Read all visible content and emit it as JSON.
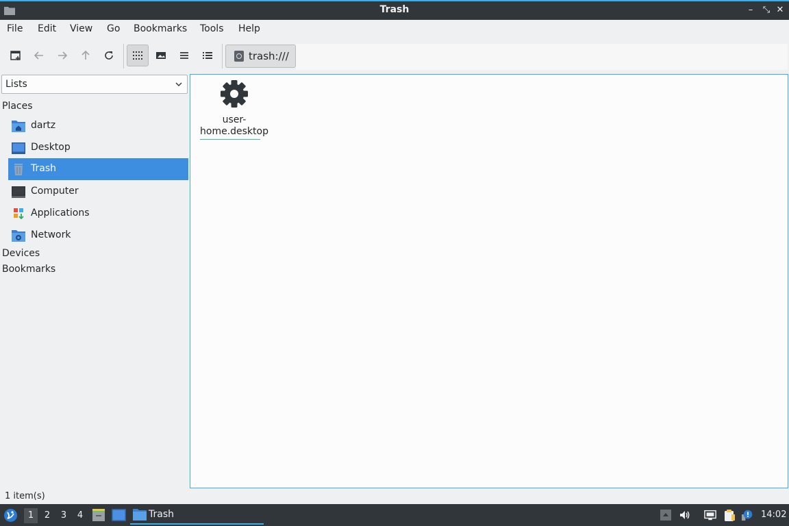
{
  "window": {
    "title": "Trash",
    "minimize_glyph": "–",
    "maximize_glyph": "⤡",
    "close_glyph": "✕"
  },
  "menubar": {
    "items": [
      "File",
      "Edit",
      "View",
      "Go",
      "Bookmarks",
      "Tools",
      "Help"
    ]
  },
  "toolbar": {
    "buttons": [
      "new-tab-icon",
      "back-arrow-icon",
      "forward-arrow-icon",
      "up-arrow-icon",
      "reload-icon",
      "icon-view-icon",
      "thumbnail-view-icon",
      "compact-view-icon",
      "detailed-list-view-icon"
    ],
    "active_view": "icon-view-icon",
    "path": "trash:///"
  },
  "sidebar": {
    "combo_value": "Lists",
    "places_header": "Places",
    "devices_header": "Devices",
    "bookmarks_header": "Bookmarks",
    "items": [
      {
        "label": "dartz",
        "icon": "home-folder-icon"
      },
      {
        "label": "Desktop",
        "icon": "desktop-icon"
      },
      {
        "label": "Trash",
        "icon": "trash-icon",
        "selected": true
      },
      {
        "label": "Computer",
        "icon": "computer-icon"
      },
      {
        "label": "Applications",
        "icon": "applications-icon"
      },
      {
        "label": "Network",
        "icon": "network-folder-icon"
      }
    ]
  },
  "files": [
    {
      "name_line1": "user-",
      "name_line2": "home.desktop",
      "icon": "gear-icon"
    }
  ],
  "status": {
    "text": "1 item(s)"
  },
  "taskbar": {
    "workspaces": [
      "1",
      "2",
      "3",
      "4"
    ],
    "active_workspace": "1",
    "task_label": "Trash",
    "clock": "14:02"
  },
  "colors": {
    "accent": "#3daee9",
    "selection": "#3d8ee0",
    "titlebar": "#31363b"
  }
}
